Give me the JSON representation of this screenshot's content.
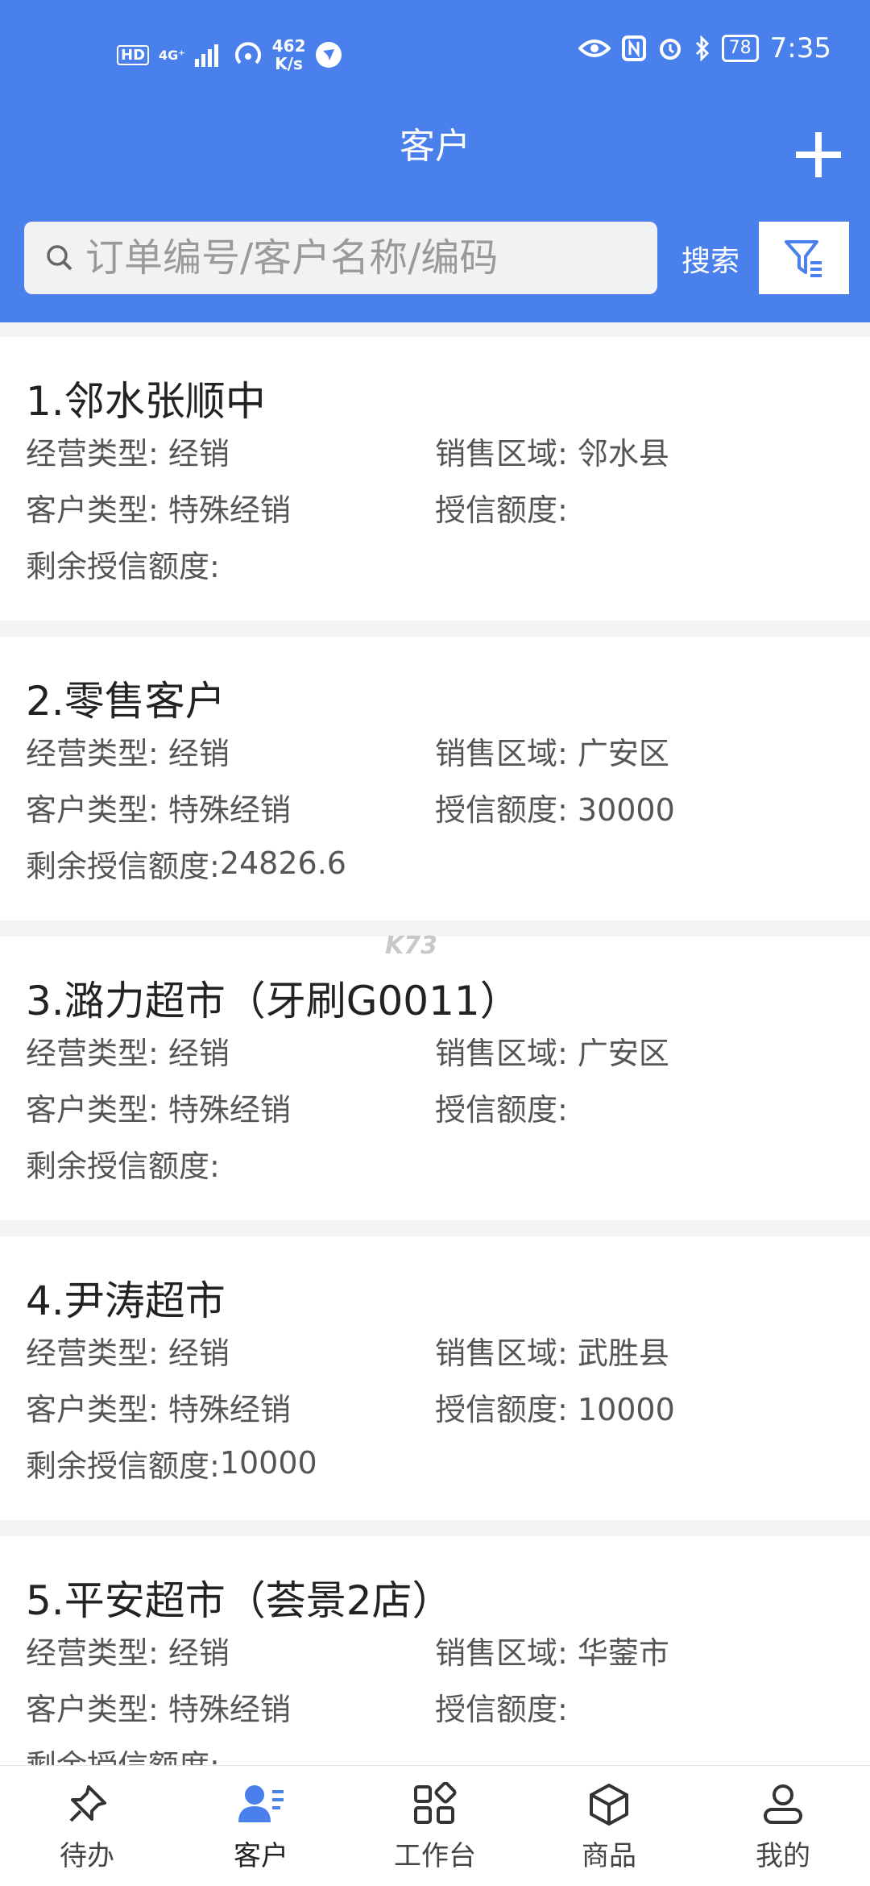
{
  "status": {
    "left_badges": [
      "HD",
      "4G⁺"
    ],
    "net_speed_value": "462",
    "net_speed_unit": "K/s",
    "battery": "78",
    "time": "7:35"
  },
  "header": {
    "title": "客户"
  },
  "search": {
    "placeholder": "订单编号/客户名称/编码",
    "button_label": "搜索"
  },
  "watermark": "K73",
  "customers": [
    {
      "title": "1.邻水张顺中",
      "business_type_label": "经营类型:",
      "business_type": "经销",
      "region_label": "销售区域:",
      "region": "邻水县",
      "customer_type_label": "客户类型:",
      "customer_type": "特殊经销",
      "credit_label": "授信额度:",
      "credit": "",
      "remaining_label": "剩余授信额度:",
      "remaining": ""
    },
    {
      "title": "2.零售客户",
      "business_type_label": "经营类型:",
      "business_type": "经销",
      "region_label": "销售区域:",
      "region": "广安区",
      "customer_type_label": "客户类型:",
      "customer_type": "特殊经销",
      "credit_label": "授信额度:",
      "credit": "30000",
      "remaining_label": "剩余授信额度:",
      "remaining": "24826.6"
    },
    {
      "title": "3.潞力超市（牙刷G0011）",
      "business_type_label": "经营类型:",
      "business_type": "经销",
      "region_label": "销售区域:",
      "region": "广安区",
      "customer_type_label": "客户类型:",
      "customer_type": "特殊经销",
      "credit_label": "授信额度:",
      "credit": "",
      "remaining_label": "剩余授信额度:",
      "remaining": ""
    },
    {
      "title": "4.尹涛超市",
      "business_type_label": "经营类型:",
      "business_type": "经销",
      "region_label": "销售区域:",
      "region": "武胜县",
      "customer_type_label": "客户类型:",
      "customer_type": "特殊经销",
      "credit_label": "授信额度:",
      "credit": "10000",
      "remaining_label": "剩余授信额度:",
      "remaining": "10000"
    },
    {
      "title": "5.平安超市（荟景2店）",
      "business_type_label": "经营类型:",
      "business_type": "经销",
      "region_label": "销售区域:",
      "region": "华蓥市",
      "customer_type_label": "客户类型:",
      "customer_type": "特殊经销",
      "credit_label": "授信额度:",
      "credit": "",
      "remaining_label": "剩余授信额度:",
      "remaining": ""
    }
  ],
  "tabs": [
    {
      "label": "待办",
      "icon": "pin-icon",
      "active": false
    },
    {
      "label": "客户",
      "icon": "customer-icon",
      "active": true
    },
    {
      "label": "工作台",
      "icon": "workbench-icon",
      "active": false
    },
    {
      "label": "商品",
      "icon": "box-icon",
      "active": false
    },
    {
      "label": "我的",
      "icon": "person-icon",
      "active": false
    }
  ],
  "colors": {
    "header": "#4a80ec",
    "accent": "#4a80ec",
    "background": "#f3f4f6"
  }
}
